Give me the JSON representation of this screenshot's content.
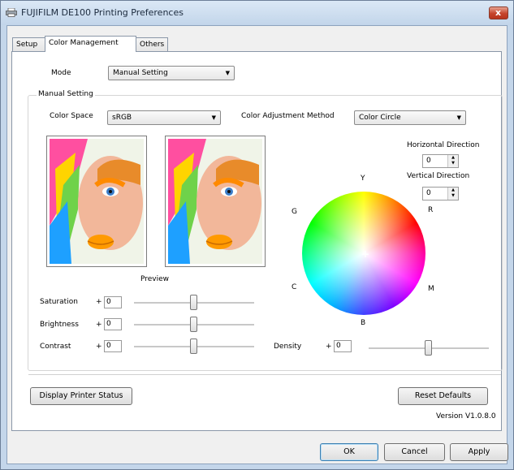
{
  "window": {
    "title": "FUJIFILM DE100 Printing Preferences",
    "close_glyph": "x"
  },
  "tabs": [
    {
      "label": "Setup",
      "active": false
    },
    {
      "label": "Color Management",
      "active": true
    },
    {
      "label": "Others",
      "active": false
    }
  ],
  "mode": {
    "label": "Mode",
    "value": "Manual Setting"
  },
  "manual": {
    "group_label": "Manual Setting",
    "color_space_label": "Color Space",
    "color_space_value": "sRGB",
    "adjust_method_label": "Color Adjustment Method",
    "adjust_method_value": "Color Circle",
    "preview_label": "Preview"
  },
  "direction": {
    "horizontal_label": "Horizontal Direction",
    "horizontal_value": "0",
    "vertical_label": "Vertical Direction",
    "vertical_value": "0"
  },
  "wheel": {
    "labels": {
      "y": "Y",
      "r": "R",
      "g": "G",
      "m": "M",
      "c": "C",
      "b": "B"
    },
    "center_glyph": "+"
  },
  "sliders": {
    "saturation": {
      "label": "Saturation",
      "sign": "+",
      "value": "0",
      "level": 0.5
    },
    "brightness": {
      "label": "Brightness",
      "sign": "+",
      "value": "0",
      "level": 0.5
    },
    "contrast": {
      "label": "Contrast",
      "sign": "+",
      "value": "0",
      "level": 0.5
    },
    "density": {
      "label": "Density",
      "sign": "+",
      "value": "0",
      "level": 0.5
    }
  },
  "buttons": {
    "display_status": "Display Printer Status",
    "reset_defaults": "Reset Defaults",
    "ok": "OK",
    "cancel": "Cancel",
    "apply": "Apply"
  },
  "version": "Version V1.0.8.0",
  "colors": {
    "accent": "#3c7fb1",
    "close": "#c5442b",
    "titlebar": "#c2d5ea"
  }
}
